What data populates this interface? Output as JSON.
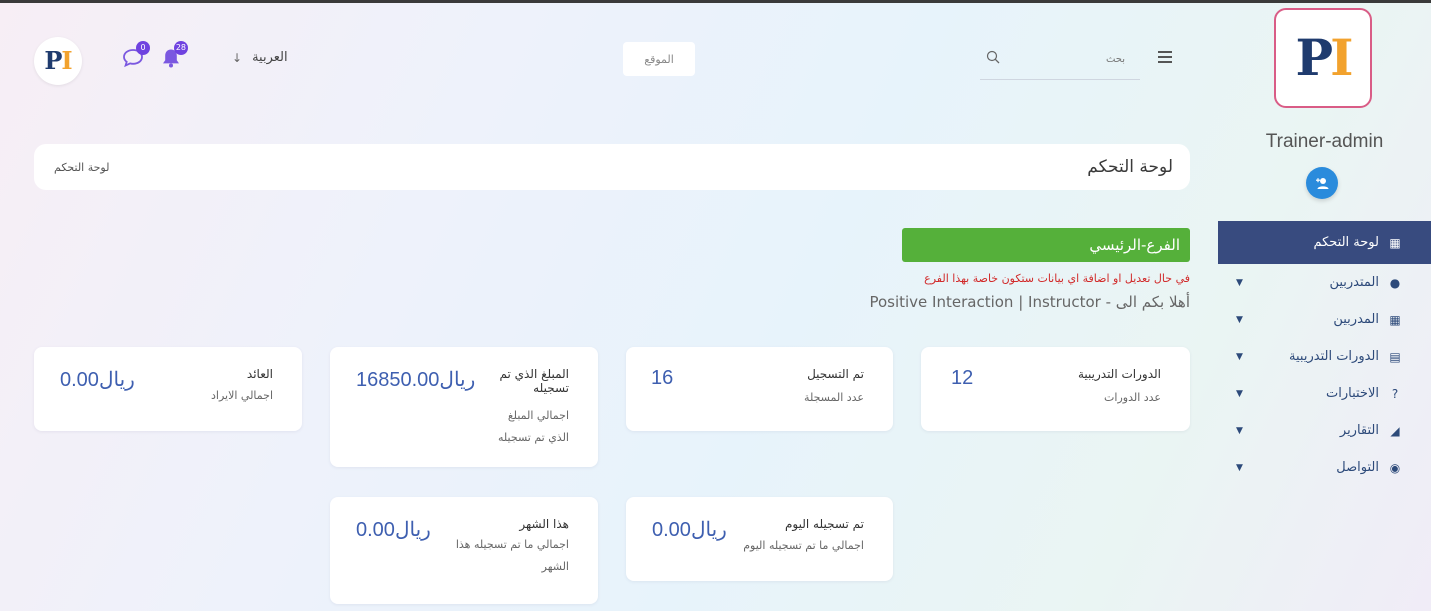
{
  "sidebar": {
    "logo": {
      "p": "P",
      "i": "I"
    },
    "username": "Trainer-admin",
    "items": [
      {
        "label": "لوحة التحكم",
        "icon": "grid-icon",
        "glyph": "▦",
        "active": true,
        "has_caret": false
      },
      {
        "label": "المتدربين",
        "icon": "user-icon",
        "glyph": "●",
        "active": false,
        "has_caret": true
      },
      {
        "label": "المدربين",
        "icon": "grid-icon",
        "glyph": "▦",
        "active": false,
        "has_caret": true
      },
      {
        "label": "الدورات التدريبية",
        "icon": "book-icon",
        "glyph": "▤",
        "active": false,
        "has_caret": true
      },
      {
        "label": "الاختبارات",
        "icon": "question-circle-icon",
        "glyph": "?",
        "active": false,
        "has_caret": true
      },
      {
        "label": "التقارير",
        "icon": "area-chart-icon",
        "glyph": "◢",
        "active": false,
        "has_caret": true
      },
      {
        "label": "التواصل",
        "icon": "comments-icon",
        "glyph": "◉",
        "active": false,
        "has_caret": true
      }
    ]
  },
  "header": {
    "language": "العربية",
    "site_button": "الموقع",
    "search_placeholder": "بحث",
    "messages_count": "0",
    "notifications_count": "28"
  },
  "breadcrumb": {
    "title": "لوحة التحكم",
    "current": "لوحة التحكم"
  },
  "branch": {
    "name": "الفرع-الرئيسي",
    "warning": "في حال تعديل او اضافة اي بيانات ستكون خاصة بهذا الفرع",
    "welcome": "أهلا بكم الى - Positive Interaction | Instructor"
  },
  "stats": {
    "courses": {
      "title": "الدورات التدريبية",
      "value": "12",
      "sub": "عدد الدورات"
    },
    "registered": {
      "title": "تم التسجيل",
      "value": "16",
      "sub": "عدد المسجلة"
    },
    "amount": {
      "title_1": "المبلغ الذي تم",
      "title_2": "تسجيله",
      "value": "16850.00ريال",
      "sub_1": "اجمالي المبلغ",
      "sub_2": "الذي تم تسجيله"
    },
    "revenue": {
      "title": "العائد",
      "value": "0.00ريال",
      "sub": "اجمالي الايراد"
    },
    "today": {
      "title": "تم تسجيله اليوم",
      "value": "0.00ريال",
      "sub": "اجمالي ما تم تسجيله اليوم"
    },
    "month": {
      "title": "هذا الشهر",
      "value": "0.00ريال",
      "sub_1": "اجمالي ما تم تسجيله هذا",
      "sub_2": "الشهر"
    }
  },
  "colors": {
    "sidebar_active": "#384b7f",
    "branch_green": "#55b03a",
    "warning_red": "#d12929",
    "value_blue": "#3e5fb0",
    "badge_purple": "#6f42e0"
  }
}
